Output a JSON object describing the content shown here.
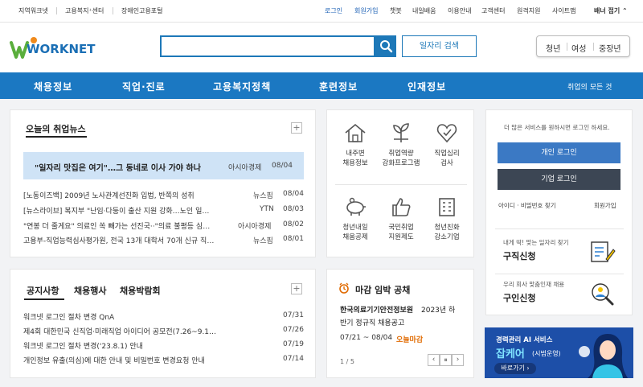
{
  "util_bar": {
    "left_links": [
      "지역워크넷",
      "고용복지⁺센터",
      "장애인고용포털"
    ],
    "login": "로그인",
    "signup": "회원가입",
    "right_links": [
      "챗봇",
      "내일배움",
      "이용안내",
      "고객센터",
      "원격지원",
      "사이트맵"
    ],
    "banner": "배너 접기 ⌃"
  },
  "logo": {
    "text": "WORKNET"
  },
  "search": {
    "value": "",
    "button": "일자리 검색"
  },
  "segments": [
    "청년",
    "여성",
    "중장년"
  ],
  "nav": {
    "items": [
      "채용정보",
      "직업·진로",
      "고용복지정책",
      "훈련정보",
      "인재정보"
    ],
    "all": "취업의 모든 것"
  },
  "news": {
    "title": "오늘의 취업뉴스",
    "headline": {
      "text": "\"일자리 맛집은 여기\"…그 동네로 이사 가야 하나",
      "source": "아시아경제",
      "date": "08/04"
    },
    "items": [
      {
        "text": "[노동이즈백] 2009년 노사관계선진화 입법, 반쪽의 성취",
        "source": "뉴스핌",
        "date": "08/04"
      },
      {
        "text": "[뉴스라이브] 복지부 \"난임·다둥이 출산 지원 강화…노인 일…",
        "source": "YTN",
        "date": "08/03"
      },
      {
        "text": "\"연봉 더 줄게요\" 의료인 쏙 빼가는 선진국··\"의료 불평등 심…",
        "source": "아시아경제",
        "date": "08/02"
      },
      {
        "text": "고용부-직업능력심사평가원, 전국 13개 대학서 70개 신규 직…",
        "source": "뉴스핌",
        "date": "08/01"
      }
    ]
  },
  "notice": {
    "tabs": [
      "공지사항",
      "채용행사",
      "채용박람회"
    ],
    "items": [
      {
        "text": "워크넷 로그인 절차 변경 QnA",
        "date": "07/31"
      },
      {
        "text": "제4회 대한민국 신직업·미래직업 아이디어 공모전(7.26~9.1…",
        "date": "07/26"
      },
      {
        "text": "워크넷 로그인 절차 변경('23.8.1) 안내",
        "date": "07/19"
      },
      {
        "text": "개인정보 유출(의심)에 대한 안내 및 비밀번호 변경요청 안내",
        "date": "07/14"
      }
    ]
  },
  "services": [
    [
      "내주변",
      "채용정보"
    ],
    [
      "취업역량",
      "강화프로그램"
    ],
    [
      "직업심리",
      "검사"
    ],
    [
      "청년내일",
      "채움공제"
    ],
    [
      "국민취업",
      "지원제도"
    ],
    [
      "청년친화",
      "강소기업"
    ]
  ],
  "deadline": {
    "title": "마감 임박 공채",
    "company": "한국의료기기안전정보원",
    "desc": "2023년 하",
    "desc2": "반기 정규직 채용공고",
    "period": "07/21 ~ 08/04",
    "badge": "오늘마감",
    "pager": "1 / 5"
  },
  "login_panel": {
    "msg": "더 많은 서비스를 원하시면 로그인 하세요.",
    "personal": "개인 로그인",
    "corporate": "기업 로그인",
    "find": "아이디 · 비밀번호 찾기",
    "signup": "회원가입"
  },
  "job_seek": {
    "sub": "내게 딱! 맞는 일자리 찾기",
    "title": "구직신청"
  },
  "job_offer": {
    "sub": "우리 회사 맞춤인재 채용",
    "title": "구인신청"
  },
  "banner_ad": {
    "line1": "경력관리 AI 서비스",
    "line2": "잡케어",
    "line3": "(시범운영)",
    "button": "바로가기 ›"
  },
  "colors": {
    "primary": "#1b78c2",
    "dark": "#3c4654",
    "accent": "#e06a00"
  }
}
